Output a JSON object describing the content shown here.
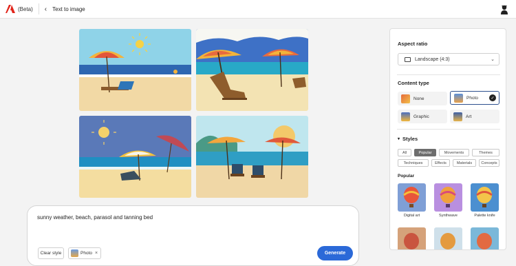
{
  "app": {
    "beta_label": "(Beta)",
    "page_title": "Text to image"
  },
  "prompt": {
    "text": "sunny weather, beach, parasol and tanning bed",
    "clear_style_label": "Clear style",
    "photo_chip_label": "Photo",
    "generate_label": "Generate"
  },
  "panel": {
    "aspect_ratio_title": "Aspect ratio",
    "aspect_ratio_value": "Landscape (4:3)",
    "content_type_title": "Content type",
    "content_types": [
      {
        "label": "None"
      },
      {
        "label": "Photo",
        "selected": true
      },
      {
        "label": "Graphic"
      },
      {
        "label": "Art"
      }
    ],
    "styles_title": "Styles",
    "style_tags": [
      "All",
      "Popular",
      "Movements",
      "Themes",
      "Techniques",
      "Effects",
      "Materials",
      "Concepts"
    ],
    "active_tag": "Popular",
    "popular_title": "Popular",
    "popular_items": [
      {
        "label": "Digital art"
      },
      {
        "label": "Synthwave"
      },
      {
        "label": "Palette knife"
      }
    ]
  },
  "colors": {
    "accent": "#2b69d8",
    "selected_border": "#2c4f8d"
  },
  "icons": [
    "adobe-logo-icon",
    "back-arrow-icon",
    "profile-icon",
    "aspect-landscape-icon",
    "chevron-down-icon",
    "check-icon",
    "close-icon"
  ]
}
